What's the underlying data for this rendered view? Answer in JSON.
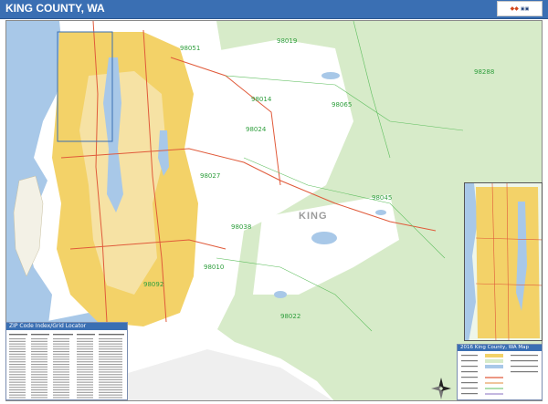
{
  "header": {
    "title": "KING COUNTY, WA",
    "title_color": "#ffffff",
    "bar_color": "#3a6fb3"
  },
  "brand_logo": {
    "icon": "map-brand-logo-icon"
  },
  "map": {
    "region_label": "KING",
    "zip_labels": [
      "98019",
      "98288",
      "98045",
      "98065",
      "98014",
      "98024",
      "98027",
      "98038",
      "98010",
      "98092",
      "98022",
      "98051"
    ],
    "colors": {
      "water": "#a8c8e8",
      "forest": "#d7ebc9",
      "urban": "#f3d268",
      "roads": "#e05a3a",
      "zip_boundary": "#5fbf5f"
    }
  },
  "index_table": {
    "title": "ZIP Code Index/Grid Locator"
  },
  "legend": {
    "title": "2016 King County, WA Map"
  },
  "compass": {
    "icon": "north-arrow-compass-icon"
  }
}
